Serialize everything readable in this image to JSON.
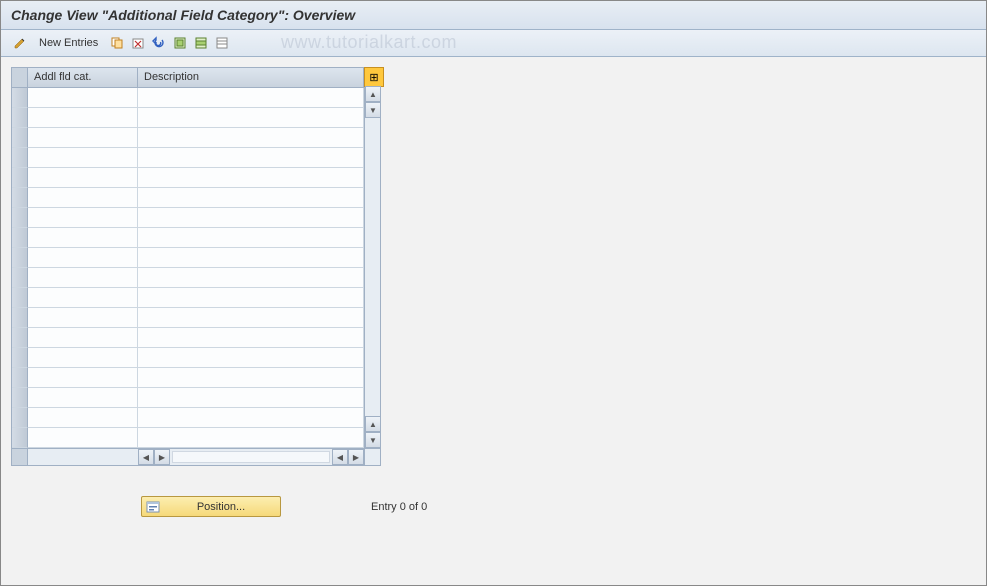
{
  "title": "Change View \"Additional Field Category\": Overview",
  "toolbar": {
    "new_entries_label": "New Entries"
  },
  "watermark": "www.tutorialkart.com",
  "table": {
    "columns": {
      "col1": "Addl fld cat.",
      "col2": "Description"
    },
    "row_count": 18
  },
  "position_button_label": "Position...",
  "status_text": "Entry 0 of 0",
  "icons": {
    "config": "⊞"
  }
}
